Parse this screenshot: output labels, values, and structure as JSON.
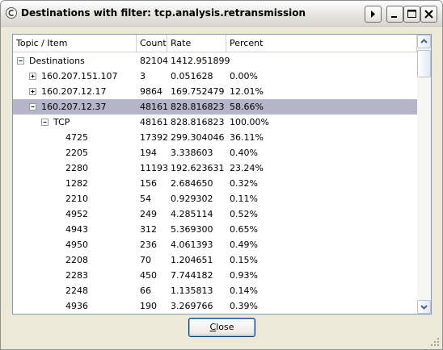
{
  "window": {
    "title": "Destinations with filter: tcp.analysis.retransmission"
  },
  "columns": [
    "Topic / Item",
    "Count",
    "Rate",
    "Percent"
  ],
  "rows": [
    {
      "item": "Destinations",
      "count": "82104",
      "rate": "1412.951899",
      "percent": "",
      "level": 0,
      "expander": "minus",
      "selected": false
    },
    {
      "item": "160.207.151.107",
      "count": "3",
      "rate": "0.051628",
      "percent": "0.00%",
      "level": 1,
      "expander": "plus",
      "selected": false
    },
    {
      "item": "160.207.12.17",
      "count": "9864",
      "rate": "169.752479",
      "percent": "12.01%",
      "level": 1,
      "expander": "plus",
      "selected": false
    },
    {
      "item": "160.207.12.37",
      "count": "48161",
      "rate": "828.816823",
      "percent": "58.66%",
      "level": 1,
      "expander": "minus",
      "selected": true
    },
    {
      "item": "TCP",
      "count": "48161",
      "rate": "828.816823",
      "percent": "100.00%",
      "level": 2,
      "expander": "minus",
      "selected": false
    },
    {
      "item": "4725",
      "count": "17392",
      "rate": "299.304046",
      "percent": "36.11%",
      "level": 3,
      "expander": "",
      "selected": false
    },
    {
      "item": "2205",
      "count": "194",
      "rate": "3.338603",
      "percent": "0.40%",
      "level": 3,
      "expander": "",
      "selected": false
    },
    {
      "item": "2280",
      "count": "11193",
      "rate": "192.623631",
      "percent": "23.24%",
      "level": 3,
      "expander": "",
      "selected": false
    },
    {
      "item": "1282",
      "count": "156",
      "rate": "2.684650",
      "percent": "0.32%",
      "level": 3,
      "expander": "",
      "selected": false
    },
    {
      "item": "2210",
      "count": "54",
      "rate": "0.929302",
      "percent": "0.11%",
      "level": 3,
      "expander": "",
      "selected": false
    },
    {
      "item": "4952",
      "count": "249",
      "rate": "4.285114",
      "percent": "0.52%",
      "level": 3,
      "expander": "",
      "selected": false
    },
    {
      "item": "4943",
      "count": "312",
      "rate": "5.369300",
      "percent": "0.65%",
      "level": 3,
      "expander": "",
      "selected": false
    },
    {
      "item": "4950",
      "count": "236",
      "rate": "4.061393",
      "percent": "0.49%",
      "level": 3,
      "expander": "",
      "selected": false
    },
    {
      "item": "2208",
      "count": "70",
      "rate": "1.204651",
      "percent": "0.15%",
      "level": 3,
      "expander": "",
      "selected": false
    },
    {
      "item": "2283",
      "count": "450",
      "rate": "7.744182",
      "percent": "0.93%",
      "level": 3,
      "expander": "",
      "selected": false
    },
    {
      "item": "2248",
      "count": "66",
      "rate": "1.135813",
      "percent": "0.14%",
      "level": 3,
      "expander": "",
      "selected": false
    },
    {
      "item": "4936",
      "count": "190",
      "rate": "3.269766",
      "percent": "0.39%",
      "level": 3,
      "expander": "",
      "selected": false
    }
  ],
  "footer": {
    "close_mnemonic": "C",
    "close_rest": "lose"
  },
  "icons": {
    "app": "wireshark-app-icon",
    "menu": "window-menu-arrow-icon",
    "minimize": "minimize-icon",
    "maximize": "maximize-icon",
    "close": "close-icon",
    "scroll_up": "scroll-up-arrow-icon",
    "scroll_down": "scroll-down-arrow-icon",
    "grip": "resize-grip-icon"
  },
  "colors": {
    "selection": "#b5b5c8",
    "window_bg": "#ece9d8"
  }
}
